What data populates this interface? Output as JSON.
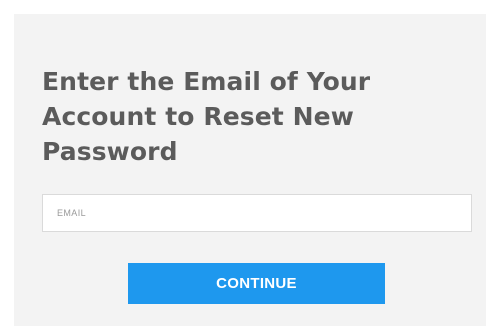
{
  "form": {
    "heading": "Enter the Email of Your Account to Reset New Password",
    "email_placeholder": "EMAIL",
    "email_value": "",
    "continue_label": "CONTINUE"
  },
  "colors": {
    "panel_background": "#f3f3f3",
    "heading_text": "#5b5b5b",
    "button_background": "#1e98ee",
    "button_text": "#ffffff"
  }
}
